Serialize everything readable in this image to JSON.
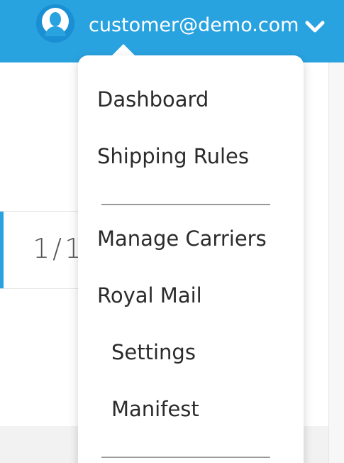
{
  "header": {
    "user_email": "customer@demo.com",
    "avatar_icon": "user-avatar-icon",
    "menu_toggle_icon": "chevron-down-icon",
    "bg_color": "#29a3e0"
  },
  "background": {
    "pagination_text": "1/1"
  },
  "user_menu": {
    "items": [
      {
        "label": "Dashboard"
      },
      {
        "label": "Shipping Rules"
      },
      {
        "label": "Manage Carriers"
      },
      {
        "label": "Royal Mail"
      },
      {
        "label": "Settings"
      },
      {
        "label": "Manifest"
      }
    ]
  }
}
